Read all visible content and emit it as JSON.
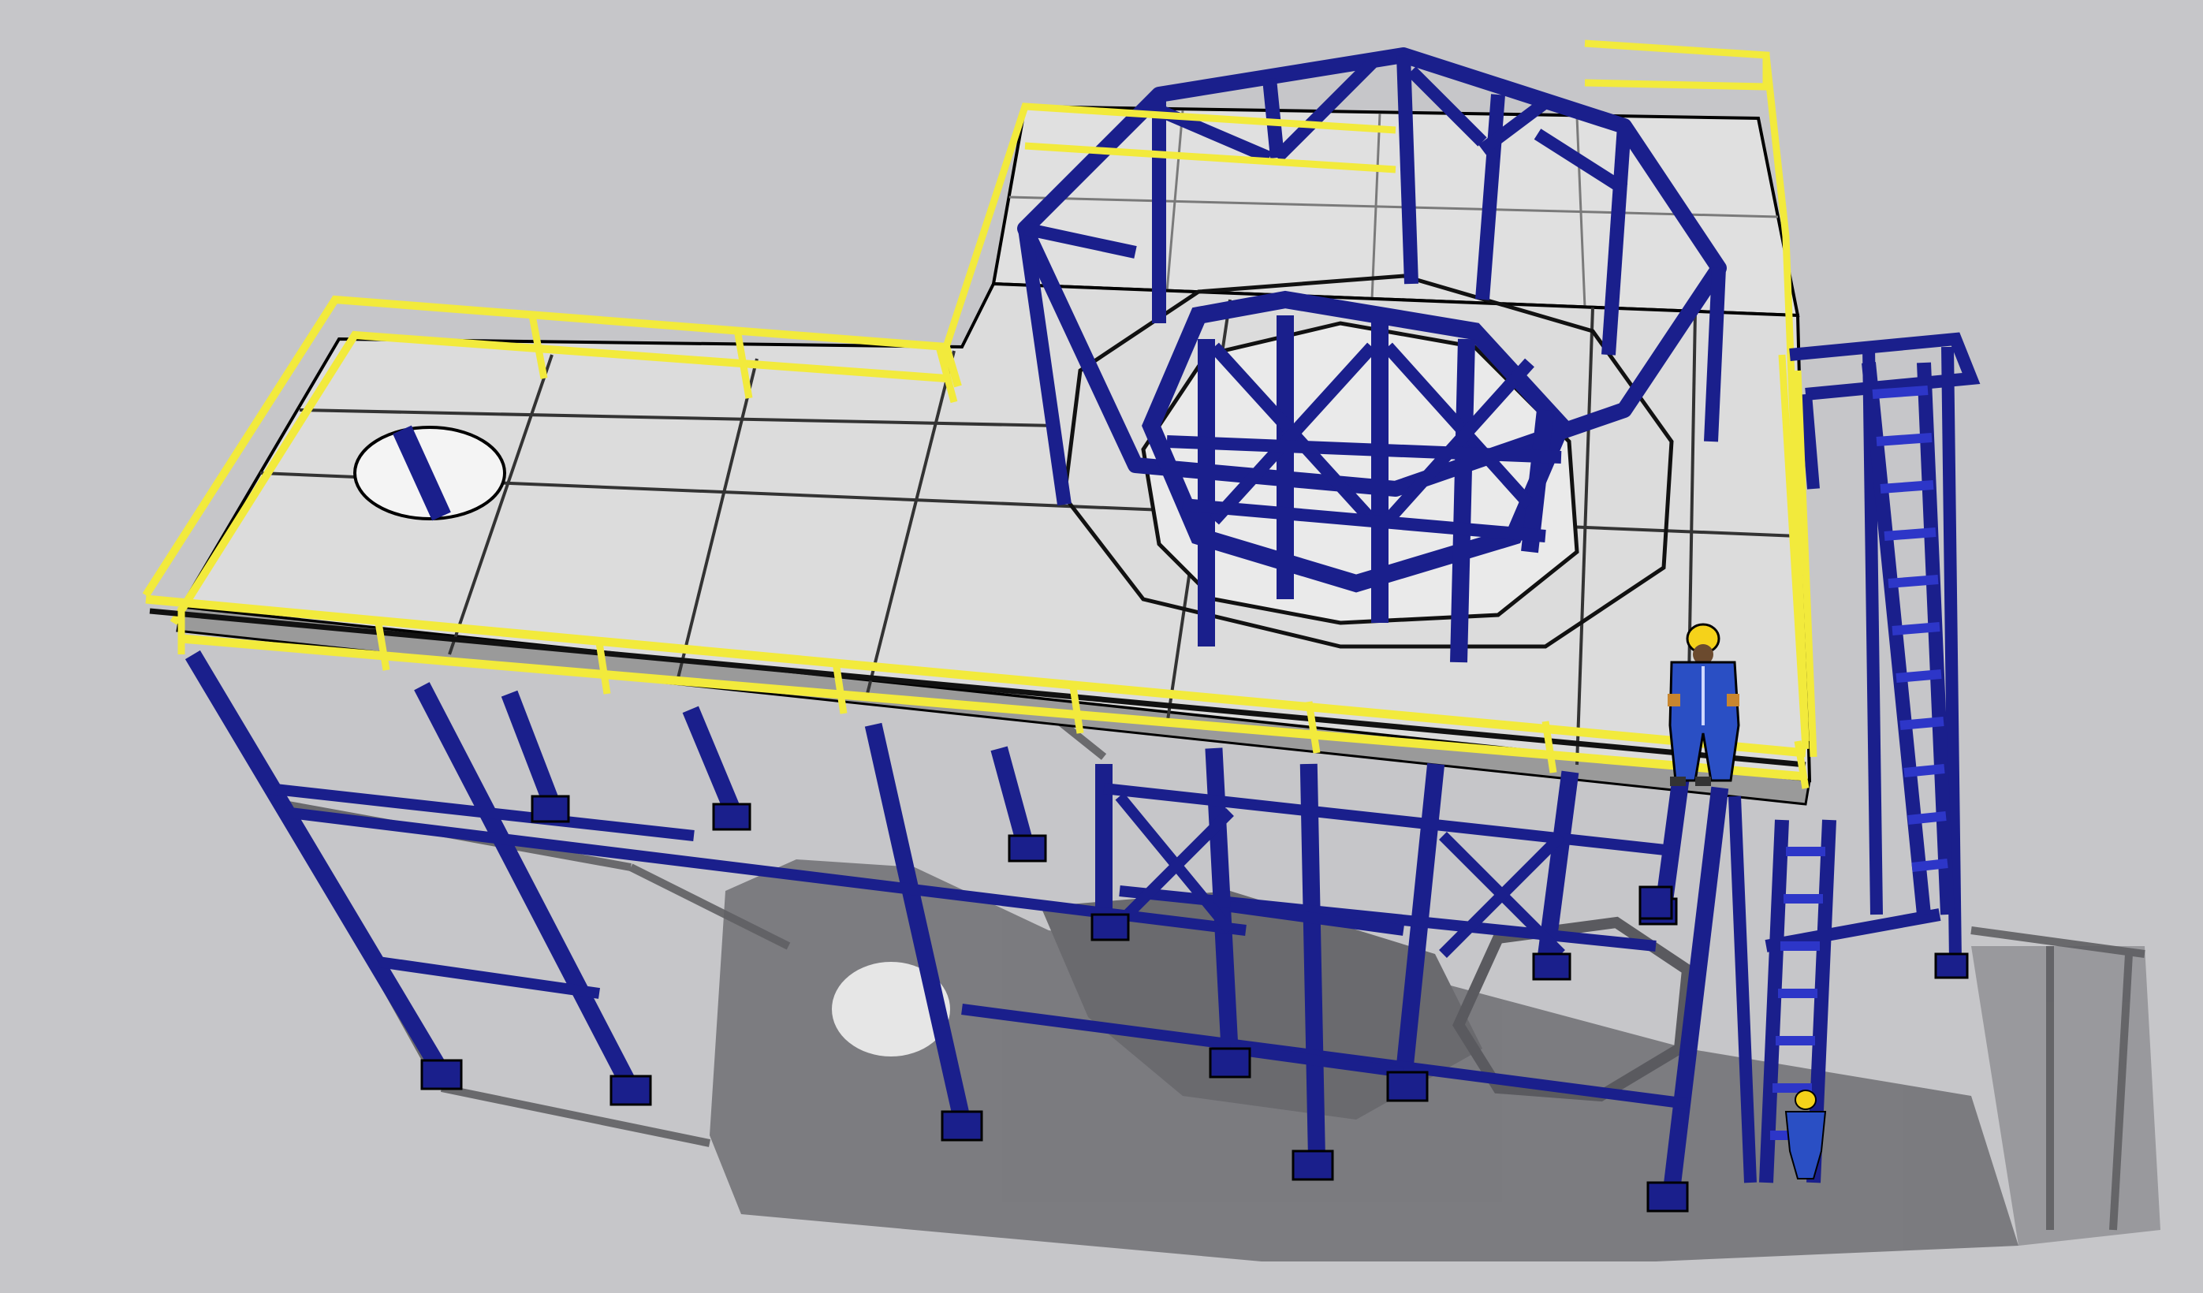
{
  "scene": {
    "description_visible_text": [],
    "colors": {
      "background": "#c6c6c9",
      "shadow": "#6e6e73",
      "deck": "#dcdcdc",
      "steel": "#1a1f8c",
      "steel_dark": "#0f1360",
      "handrail": "#f2ea3c",
      "edge": "#000000",
      "worker_suit": "#2a4fc4",
      "helmet": "#f5d21a"
    },
    "components": {
      "platform": "platform-deck",
      "tank_ring": "octagonal-tank-frame",
      "stairs": "stair-tower",
      "workers": 2
    }
  }
}
